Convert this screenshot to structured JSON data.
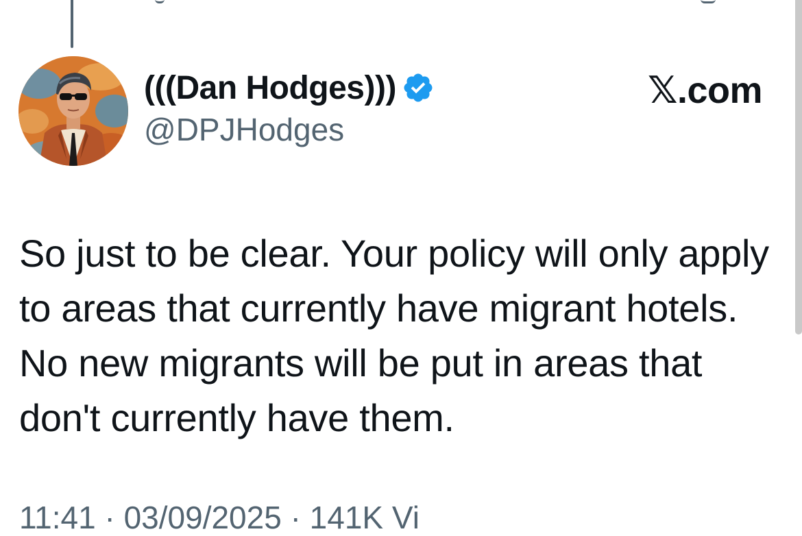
{
  "tweet": {
    "author": {
      "display_name": "(((Dan Hodges)))",
      "handle": "@DPJHodges",
      "verified": true,
      "verified_color": "#1d9bf0",
      "avatar": "cartoon-man-sunglasses-avatar"
    },
    "brand": "𝕏.com",
    "text": "So just to be clear. Your policy will only apply to areas that currently have migrant hotels. No new migrants will be put in areas that don't currently have them.",
    "meta_partial": "11:41 · 03/09/2025 · 141K Vi"
  },
  "colors": {
    "text_primary": "#0f1419",
    "text_secondary": "#536471",
    "background": "#ffffff"
  }
}
